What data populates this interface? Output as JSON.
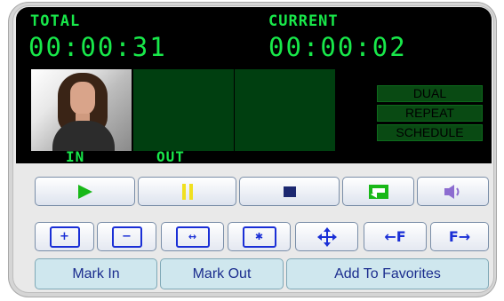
{
  "display": {
    "total_label": "TOTAL",
    "total_time": "00:00:31",
    "current_label": "CURRENT",
    "current_time": "00:00:02",
    "in_label": "IN",
    "out_label": "OUT",
    "modes": [
      "DUAL",
      "REPEAT",
      "SCHEDULE"
    ]
  },
  "transport": {
    "play_icon": "play-icon",
    "pause_icon": "pause-icon",
    "stop_icon": "stop-icon",
    "repeat_icon": "repeat-icon",
    "volume_icon": "volume-icon"
  },
  "navigation": {
    "zoom_in": "zoom-in-icon",
    "zoom_out": "zoom-out-icon",
    "fit": "fit-width-icon",
    "expand": "expand-icon",
    "move": "move-icon",
    "prev_frame_label": "←F",
    "next_frame_label": "F→"
  },
  "actions": {
    "mark_in": "Mark In",
    "mark_out": "Mark Out",
    "add_favorites": "Add To Favorites"
  },
  "colors": {
    "lcd_green": "#18e84a",
    "play_green": "#18b818",
    "pause_yellow": "#f0e020",
    "stop_navy": "#1c2870",
    "volume_purple": "#8c6cd0",
    "nav_blue": "#1a2fd6"
  }
}
